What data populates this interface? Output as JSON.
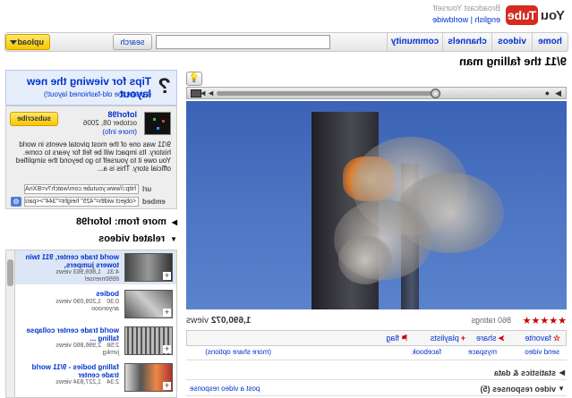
{
  "header": {
    "logo_you": "You",
    "logo_tube": "Tube",
    "tagline": "Broadcast Yourself",
    "lang_line": "english | worldwide",
    "nav": [
      "home",
      "videos",
      "channels",
      "community"
    ],
    "search_label": "search",
    "upload_label": "upload"
  },
  "video": {
    "title": "9/11 the falling man",
    "rating_count": "860 ratings",
    "views_label": "views",
    "views_count": "1,690,072",
    "actions": {
      "favorite": "favorite",
      "playlists": "playlists",
      "share": "share",
      "flag": "flag"
    },
    "share_links": [
      "(more share options)",
      "facebook",
      "myspace",
      "send video"
    ],
    "sections": {
      "stats": "statistics & data",
      "responses": "video responses (5)",
      "post_response": "post a video response"
    },
    "progress": 0.02
  },
  "sidebar": {
    "tips_title": "Tips for viewing the new layout",
    "tips_link": "(I prefer the old-fashioned layout!)",
    "uploader": {
      "name": "loforl98",
      "date": "october 08, 2006",
      "more_info": "(more info)",
      "subscribe": "subscribe",
      "description": "9/11 was one of the most pivotal events in world history. Its impact will be felt for years to come. You owe it to yourself to go beyond the simplified official story. This is a..."
    },
    "url_label": "url",
    "url_value": "http://www.youtube.com/watch?v=BXnA9F...",
    "embed_label": "embed",
    "embed_value": "<object width=\"425\" height=\"344\"><param",
    "more_from": "more from: loforl98",
    "related_heading": "related videos",
    "related": [
      {
        "title": "world trade center, 911 twin towers jumpers,",
        "meta1": "4:31",
        "meta2": "1,869,963 views",
        "meta3": "8990mensel"
      },
      {
        "title": "bodies",
        "meta1": "0:30",
        "meta2": "1,209,090 views",
        "meta3": "anyonooo"
      },
      {
        "title": "world trade center collapse falling ...",
        "meta1": "2:58",
        "meta2": "2,996,860 views",
        "meta3": "jvmkg"
      },
      {
        "title": "falling bodies - 9/11 world trade center",
        "meta1": "2:34",
        "meta2": "1,227,834 views",
        "meta3": ""
      }
    ]
  },
  "colors": {
    "brand_red": "#d52b20",
    "link_blue": "#0033cc",
    "upload_yellow": "#f7c700"
  }
}
